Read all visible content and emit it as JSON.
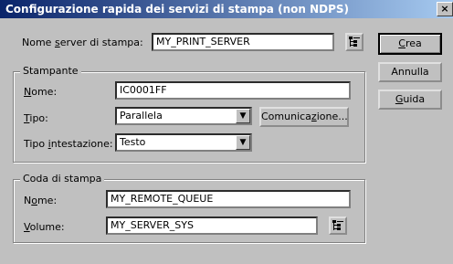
{
  "window": {
    "title": "Configurazione rapida dei servizi di stampa (non NDPS)",
    "close_glyph": "×"
  },
  "server": {
    "label_pre": "Nome ",
    "label_key": "s",
    "label_post": "erver di stampa:",
    "value": "MY_PRINT_SERVER"
  },
  "printer_group": {
    "legend": "Stampante",
    "name_label_key": "N",
    "name_label_post": "ome:",
    "name_value": "IC0001FF",
    "type_label_key": "T",
    "type_label_post": "ipo:",
    "type_value": "Parallela",
    "comm_button_pre": "Comunica",
    "comm_button_key": "z",
    "comm_button_post": "ione...",
    "header_label_pre": "Tipo ",
    "header_label_key": "i",
    "header_label_post": "ntestazione:",
    "header_value": "Testo"
  },
  "queue_group": {
    "legend": "Coda di stampa",
    "name_label_pre": "N",
    "name_label_key": "o",
    "name_label_post": "me:",
    "name_value": "MY_REMOTE_QUEUE",
    "volume_label_key": "V",
    "volume_label_post": "olume:",
    "volume_value": "MY_SERVER_SYS"
  },
  "buttons": {
    "create_key": "C",
    "create_post": "rea",
    "cancel": "Annulla",
    "help_key": "G",
    "help_post": "uida"
  },
  "icons": {
    "browse": "browse-tree-icon",
    "dropdown": "chevron-down-icon"
  }
}
